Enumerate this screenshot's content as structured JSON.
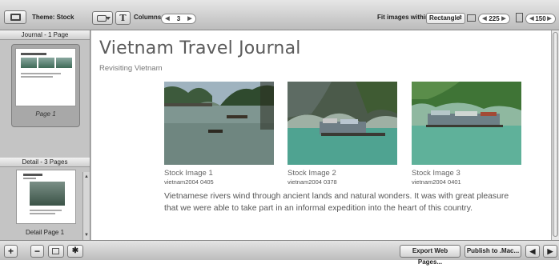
{
  "toolbar": {
    "theme_label": "Theme: Stock",
    "text_button": "T",
    "columns_label": "Columns:",
    "columns_value": "3",
    "fit_label": "Fit images within:",
    "fit_value": "Rectangle",
    "width_value": "225",
    "height_value": "150"
  },
  "sidebar": {
    "journal_header": "Journal - 1 Page",
    "journal_thumb_caption": "Page 1",
    "detail_header": "Detail - 3 Pages",
    "detail_thumb_caption": "Detail Page 1"
  },
  "page": {
    "title": "Vietnam Travel Journal",
    "subtitle": "Revisiting Vietnam",
    "images": [
      {
        "caption": "Stock Image 1",
        "id": "vietnam2004 0405"
      },
      {
        "caption": "Stock Image 2",
        "id": "vietnam2004 0378"
      },
      {
        "caption": "Stock Image 3",
        "id": "vietnam2004 0401"
      }
    ],
    "body": "Vietnamese rivers wind through ancient lands and natural wonders. It was with great pleasure that we were able to take part in an informal expedition into the heart of this country."
  },
  "bottombar": {
    "add_label": "+",
    "remove_label": "−",
    "gear_label": "✱",
    "export_label": "Export Web Pages...",
    "publish_label": "Publish to .Mac...",
    "back_label": "◀",
    "forward_label": "▶"
  },
  "icons": {
    "theme": "theme-icon",
    "photo": "camera-icon",
    "width": "width-icon",
    "height": "height-icon",
    "layout": "layout-icon",
    "gear": "gear-icon"
  }
}
